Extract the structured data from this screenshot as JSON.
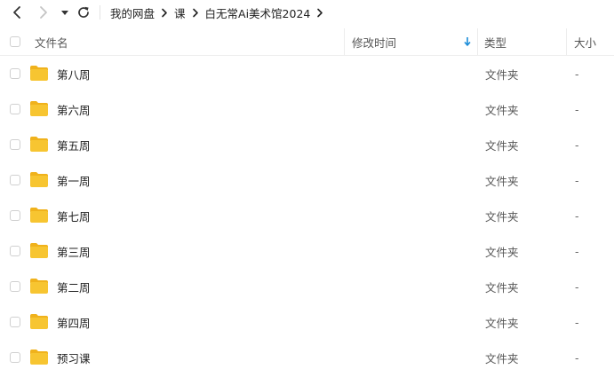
{
  "breadcrumb": [
    "我的网盘",
    "课",
    "白无常Ai美术馆2024"
  ],
  "columns": {
    "name": "文件名",
    "modified": "修改时间",
    "type": "类型",
    "size": "大小"
  },
  "files": [
    {
      "name": "第八周",
      "type": "文件夹",
      "size": "-"
    },
    {
      "name": "第六周",
      "type": "文件夹",
      "size": "-"
    },
    {
      "name": "第五周",
      "type": "文件夹",
      "size": "-"
    },
    {
      "name": "第一周",
      "type": "文件夹",
      "size": "-"
    },
    {
      "name": "第七周",
      "type": "文件夹",
      "size": "-"
    },
    {
      "name": "第三周",
      "type": "文件夹",
      "size": "-"
    },
    {
      "name": "第二周",
      "type": "文件夹",
      "size": "-"
    },
    {
      "name": "第四周",
      "type": "文件夹",
      "size": "-"
    },
    {
      "name": "预习课",
      "type": "文件夹",
      "size": "-"
    }
  ],
  "colors": {
    "folder": "#f7c531",
    "folder_tab": "#f0b21c",
    "sort_arrow": "#1a8cd8"
  }
}
